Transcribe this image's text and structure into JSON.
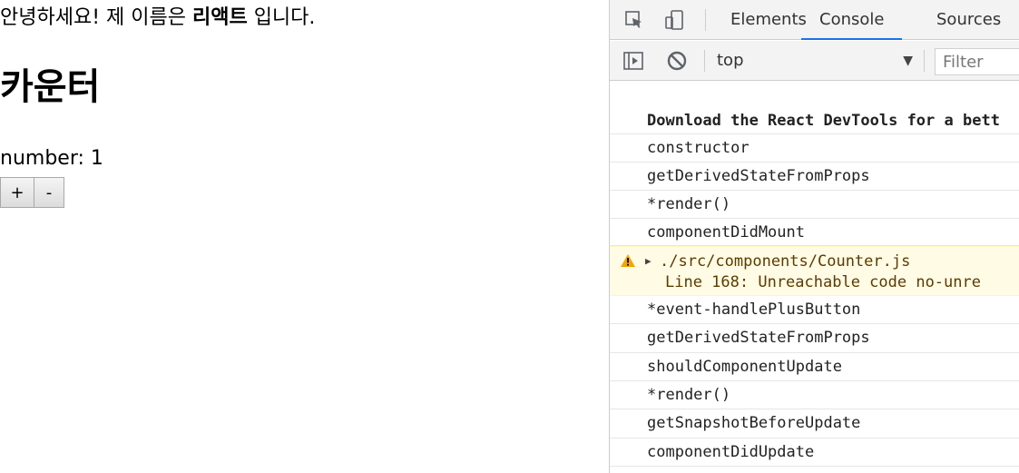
{
  "app": {
    "greeting_prefix": "안녕하세요! 제 이름은 ",
    "greeting_name": "리액트",
    "greeting_suffix": " 입니다.",
    "counter_title": "카운터",
    "number_label": "number: ",
    "number_value": "1",
    "plus_label": "+",
    "minus_label": "-"
  },
  "devtools": {
    "tabs": [
      {
        "label": "Elements",
        "active": false
      },
      {
        "label": "Console",
        "active": true
      },
      {
        "label": "Sources",
        "active": false
      }
    ],
    "context": "top",
    "filter_placeholder": "Filter",
    "console_lines": [
      {
        "text": "Download the React DevTools for a bett",
        "style": "bold"
      },
      {
        "text": "constructor"
      },
      {
        "text": "getDerivedStateFromProps"
      },
      {
        "text": "*render()"
      },
      {
        "text": "componentDidMount"
      },
      {
        "text": "./src/components/Counter.js",
        "sub": "Line 168:  Unreachable code  no-unre",
        "style": "warning"
      },
      {
        "text": "*event-handlePlusButton"
      },
      {
        "text": "getDerivedStateFromProps"
      },
      {
        "text": "shouldComponentUpdate"
      },
      {
        "text": "*render()"
      },
      {
        "text": "getSnapshotBeforeUpdate"
      },
      {
        "text": "componentDidUpdate"
      }
    ]
  },
  "colors": {
    "accent": "#1a73e8",
    "warning_bg": "#fffbe5",
    "warning_icon": "#f2a600"
  }
}
